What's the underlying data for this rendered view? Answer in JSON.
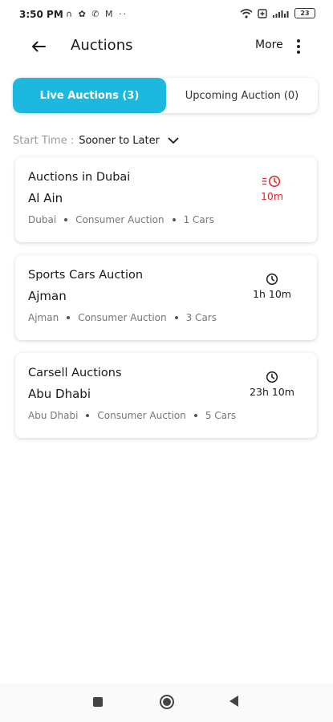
{
  "status_bar": {
    "time": "3:50 PM",
    "left_icons": [
      "headphones-icon",
      "gear-icon",
      "whatsapp-icon",
      "gmail-icon",
      "more-dots-icon"
    ],
    "battery": "23"
  },
  "header": {
    "title": "Auctions",
    "more_label": "More"
  },
  "tabs": [
    {
      "label": "Live Auctions (3)",
      "active": true
    },
    {
      "label": "Upcoming Auction (0)",
      "active": false
    }
  ],
  "sort": {
    "label": "Start Time :",
    "value": "Sooner to Later"
  },
  "auctions": [
    {
      "title": "Auctions in Dubai",
      "city": "Al Ain",
      "location": "Dubai",
      "type": "Consumer Auction",
      "cars": "1 Cars",
      "time_left": "10m",
      "urgent": true
    },
    {
      "title": "Sports Cars Auction",
      "city": "Ajman",
      "location": "Ajman",
      "type": "Consumer Auction",
      "cars": "3 Cars",
      "time_left": "1h 10m",
      "urgent": false
    },
    {
      "title": "Carsell Auctions",
      "city": "Abu Dhabi",
      "location": "Abu Dhabi",
      "type": "Consumer Auction",
      "cars": "5 Cars",
      "time_left": "23h 10m",
      "urgent": false
    }
  ],
  "colors": {
    "accent": "#1cb8dd",
    "urgent": "#e0262b"
  }
}
